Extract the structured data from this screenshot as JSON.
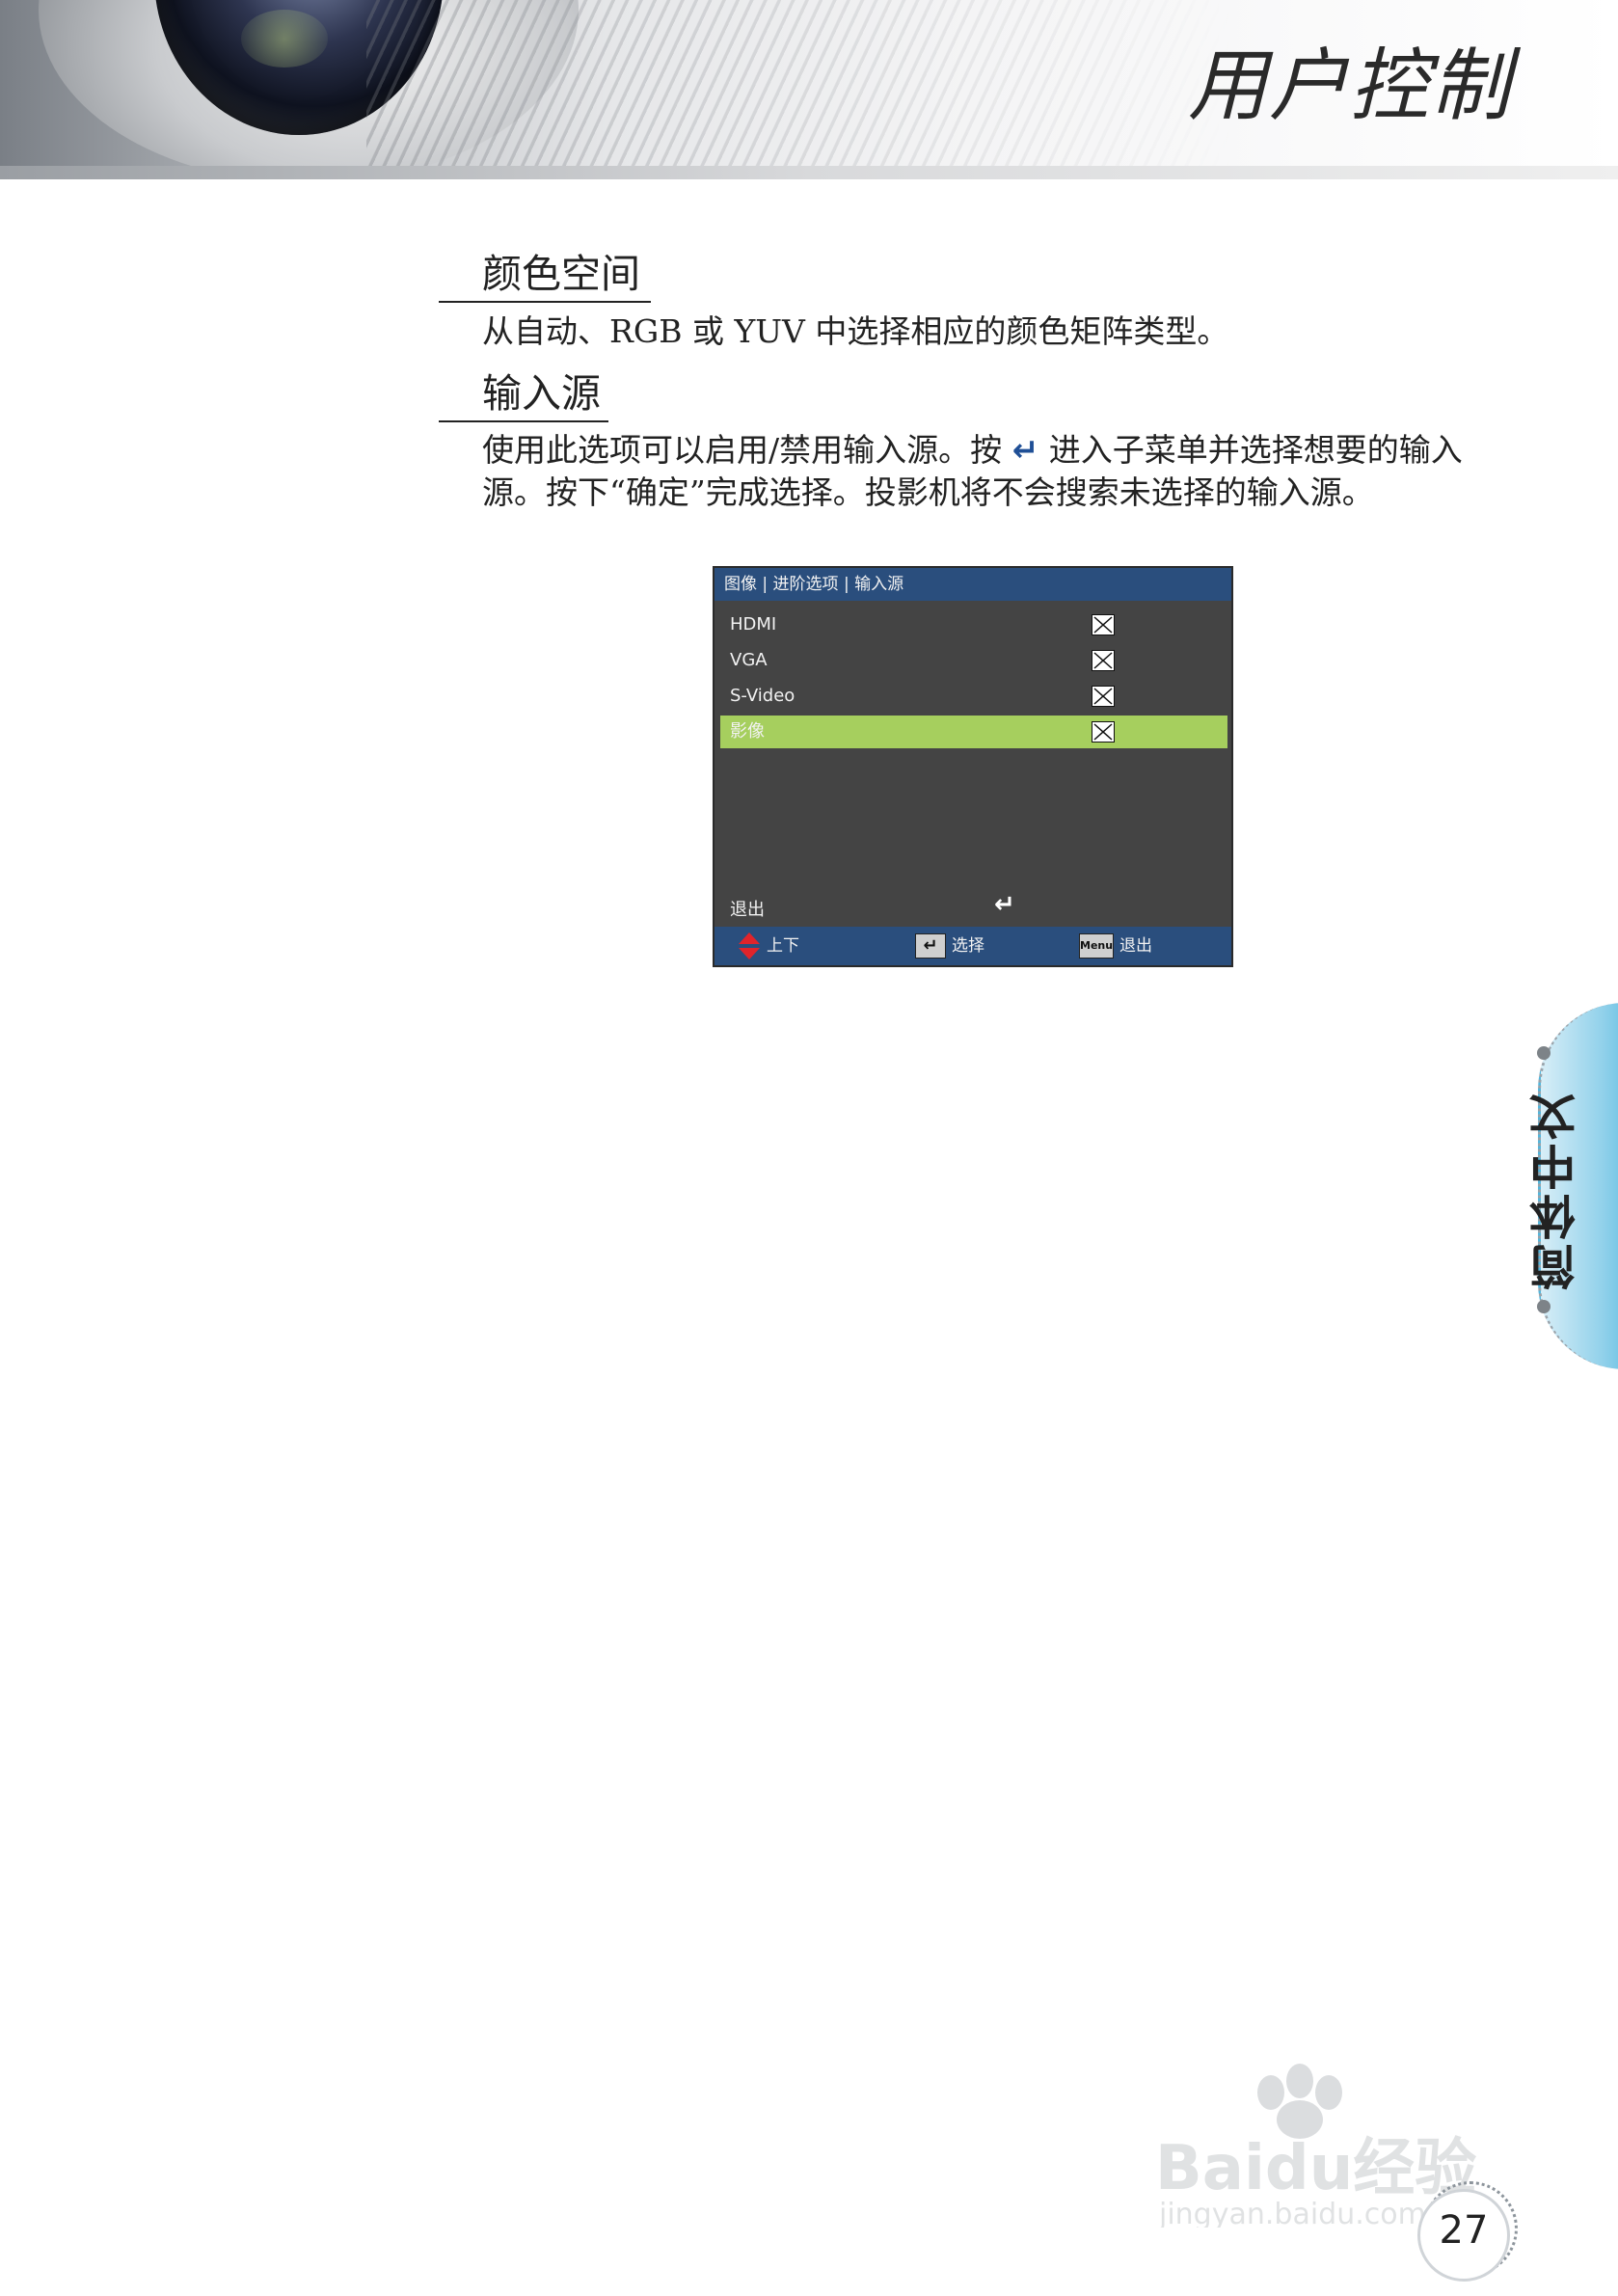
{
  "header": {
    "chapter_title": "用户控制"
  },
  "sections": [
    {
      "title": "颜色空间",
      "text": "从自动、RGB 或 YUV 中选择相应的颜色矩阵类型。"
    },
    {
      "title": "输入源",
      "text_before_icon": "使用此选项可以启用/禁用输入源。按 ",
      "enter_icon": "↵",
      "text_after_icon": " 进入子菜单并选择想要的输入源。按下“确定”完成选择。投影机将不会搜索未选择的输入源。"
    }
  ],
  "osd_menu": {
    "breadcrumb": "图像 | 进阶选项 | 输入源",
    "items": [
      {
        "label": "HDMI",
        "checked": true
      },
      {
        "label": "VGA",
        "checked": true
      },
      {
        "label": "S-Video",
        "checked": true
      },
      {
        "label": "影像",
        "checked": true,
        "selected": true
      }
    ],
    "exit_label": "退出",
    "exit_enter_icon": "↵",
    "footer": {
      "updown_label": "上下",
      "enter_key": "↵",
      "enter_label": "选择",
      "menu_key": "Menu",
      "menu_label": "退出"
    },
    "colors": {
      "background": "#444444",
      "bar": "#2a4e7d",
      "highlight": "#a6cf5e"
    }
  },
  "side_tab": {
    "label": "简体中文"
  },
  "page": {
    "number": "27"
  },
  "watermark": {
    "brand": "Baidu经验",
    "url": "jingyan.baidu.com"
  }
}
